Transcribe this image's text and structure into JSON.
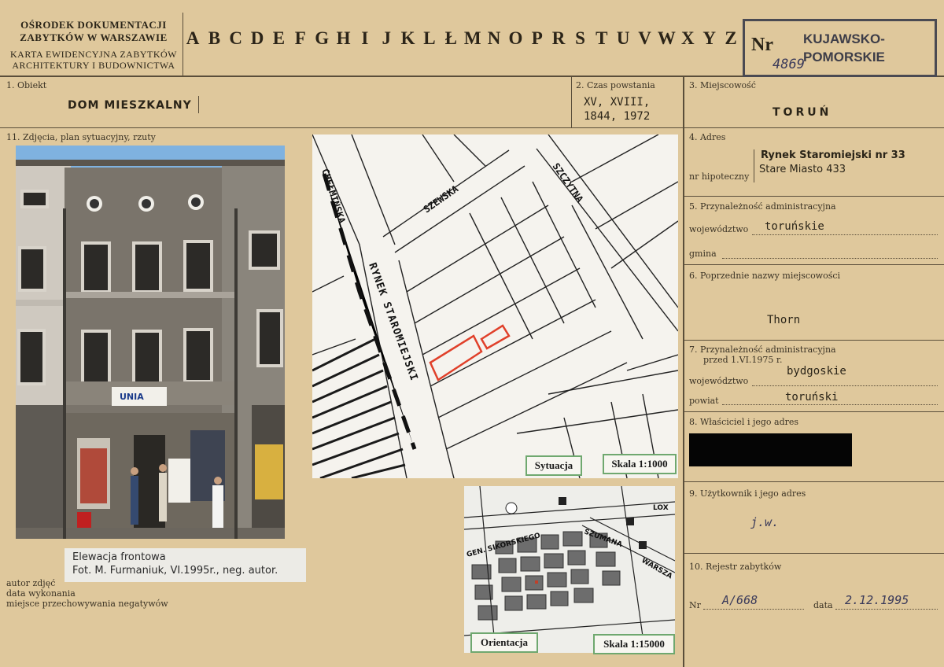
{
  "header": {
    "org_line1": "OŚRODEK DOKUMENTACJI",
    "org_line2": "ZABYTKÓW W WARSZAWIE",
    "org_line3": "KARTA EWIDENCYJNA ZABYTKÓW",
    "org_line4": "ARCHITEKTURY I BUDOWNICTWA",
    "letters": [
      "A",
      "B",
      "C",
      "D",
      "E",
      "F",
      "G",
      "H",
      "I",
      "J",
      "K",
      "L",
      "Ł",
      "M",
      "N",
      "O",
      "P",
      "R",
      "S",
      "T",
      "U",
      "V",
      "W",
      "X",
      "Y",
      "Z"
    ],
    "nr_label": "Nr",
    "nr_value": "4869",
    "stamp_line1": "KUJAWSKO-",
    "stamp_line2": "POMORSKIE"
  },
  "fields": {
    "obiekt_label": "1. Obiekt",
    "obiekt_value": "DOM MIESZKALNY",
    "czas_label": "2. Czas powstania",
    "czas_line1": "XV, XVIII,",
    "czas_line2": "1844, 1972",
    "miejscowosc_label": "3. Miejscowość",
    "miejscowosc_value": "TORUŃ",
    "zdjecia_label": "11. Zdjęcia, plan sytuacyjny, rzuty",
    "adres_label": "4. Adres",
    "adres_line1": "Rynek Staromiejski nr 33",
    "adres_line2": "Stare Miasto 433",
    "nr_hipoteczny_label": "nr hipoteczny",
    "przynaleznosc_label": "5. Przynależność administracyjna",
    "wojewodztwo_label": "województwo",
    "wojewodztwo_value": "toruńskie",
    "gmina_label": "gmina",
    "poprzednie_label": "6. Poprzednie nazwy miejscowości",
    "poprzednie_value": "Thorn",
    "przynaleznosc_przed_label": "7. Przynależność administracyjna",
    "przynaleznosc_przed_label2": "przed 1.VI.1975 r.",
    "wojewodztwo_przed_label": "województwo",
    "wojewodztwo_przed_value": "bydgoskie",
    "powiat_label": "powiat",
    "powiat_value": "toruński",
    "wlasciciel_label": "8. Właściciel i jego adres",
    "uzytkownik_label": "9. Użytkownik i jego adres",
    "uzytkownik_value": "j.w.",
    "rejestr_label": "10. Rejestr zabytków",
    "rejestr_nr_label": "Nr",
    "rejestr_nr_value": "A/668",
    "rejestr_data_label": "data",
    "rejestr_data_value": "2.12.1995"
  },
  "photo": {
    "caption_line1": "Elewacja frontowa",
    "caption_line2": "Fot. M. Furmaniuk, VI.1995r., neg. autor.",
    "sign_unia": "UNIA",
    "autor_label": "autor zdjęć",
    "data_label": "data wykonania",
    "miejsce_label": "miejsce przechowywania negatywów"
  },
  "map": {
    "street_chelminska": "CHEŁMIŃSKA",
    "street_szewska": "SZEWSKA",
    "street_szczytna": "SZCZYTNA",
    "street_rynek": "RYNEK STAROMIEJSKI",
    "sytuacja_label": "Sytuacja",
    "skala1_label": "Skala 1:1000",
    "orientacja_label": "Orientacja",
    "skala2_label": "Skala 1:15000",
    "map2_sikorskiego": "GEN. SIKORSKIEGO",
    "map2_szumana": "SZUMANA",
    "map2_warsza": "WARSZA",
    "map2_lox": "LOX"
  },
  "colors": {
    "card": "#dfc89c",
    "ink": "#2a2418",
    "highlight": "#e0402a",
    "label_border": "#6fa86f"
  }
}
